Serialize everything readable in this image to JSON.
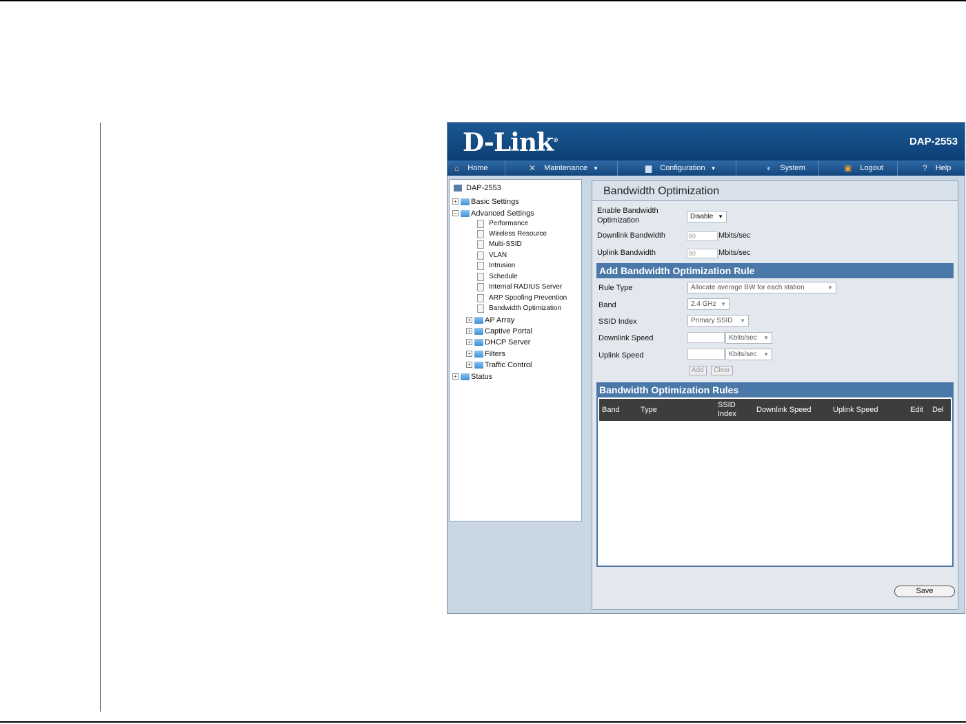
{
  "header": {
    "model": "DAP-2553",
    "logo": "D-Link"
  },
  "nav": [
    {
      "label": "Home",
      "icon": "home-icon"
    },
    {
      "label": "Maintenance",
      "icon": "tools-icon"
    },
    {
      "label": "Configuration",
      "icon": "disk-icon"
    },
    {
      "label": "System",
      "icon": "globe-icon"
    },
    {
      "label": "Logout",
      "icon": "logout-icon"
    },
    {
      "label": "Help",
      "icon": "help-icon"
    }
  ],
  "tree": {
    "root": "DAP-2553",
    "basic": "Basic Settings",
    "advanced": "Advanced Settings",
    "children": [
      "Performance",
      "Wireless Resource",
      "Multi-SSID",
      "VLAN",
      "Intrusion",
      "Schedule",
      "Internal RADIUS Server",
      "ARP Spoofing Prevention",
      "Bandwidth Optimization"
    ],
    "folders": [
      "AP Array",
      "Captive Portal",
      "DHCP Server",
      "Filters",
      "Traffic Control"
    ],
    "status": "Status"
  },
  "panel": {
    "title": "Bandwidth Optimization",
    "enable_label_1": "Enable Bandwidth",
    "enable_label_2": "Optimization",
    "enable_value": "Disable",
    "downlink_label": "Downlink Bandwidth",
    "downlink_value": "80",
    "uplink_label": "Uplink Bandwidth",
    "uplink_value": "80",
    "unit_mbits": "Mbits/sec",
    "add_rule": {
      "title": "Add Bandwidth Optimization Rule",
      "rule_type_label": "Rule Type",
      "rule_type_value": "Allocate average BW for each station",
      "band_label": "Band",
      "band_value": "2.4 GHz",
      "ssid_label": "SSID Index",
      "ssid_value": "Primary SSID",
      "downlink_speed_label": "Downlink Speed",
      "uplink_speed_label": "Uplink Speed",
      "unit_kbits": "Kbits/sec",
      "add_btn": "Add",
      "clear_btn": "Clear"
    },
    "rules": {
      "title": "Bandwidth Optimization Rules",
      "columns": [
        "Band",
        "Type",
        "SSID",
        "Index",
        "Downlink Speed",
        "Uplink Speed",
        "Edit",
        "Del"
      ]
    },
    "save": "Save"
  }
}
